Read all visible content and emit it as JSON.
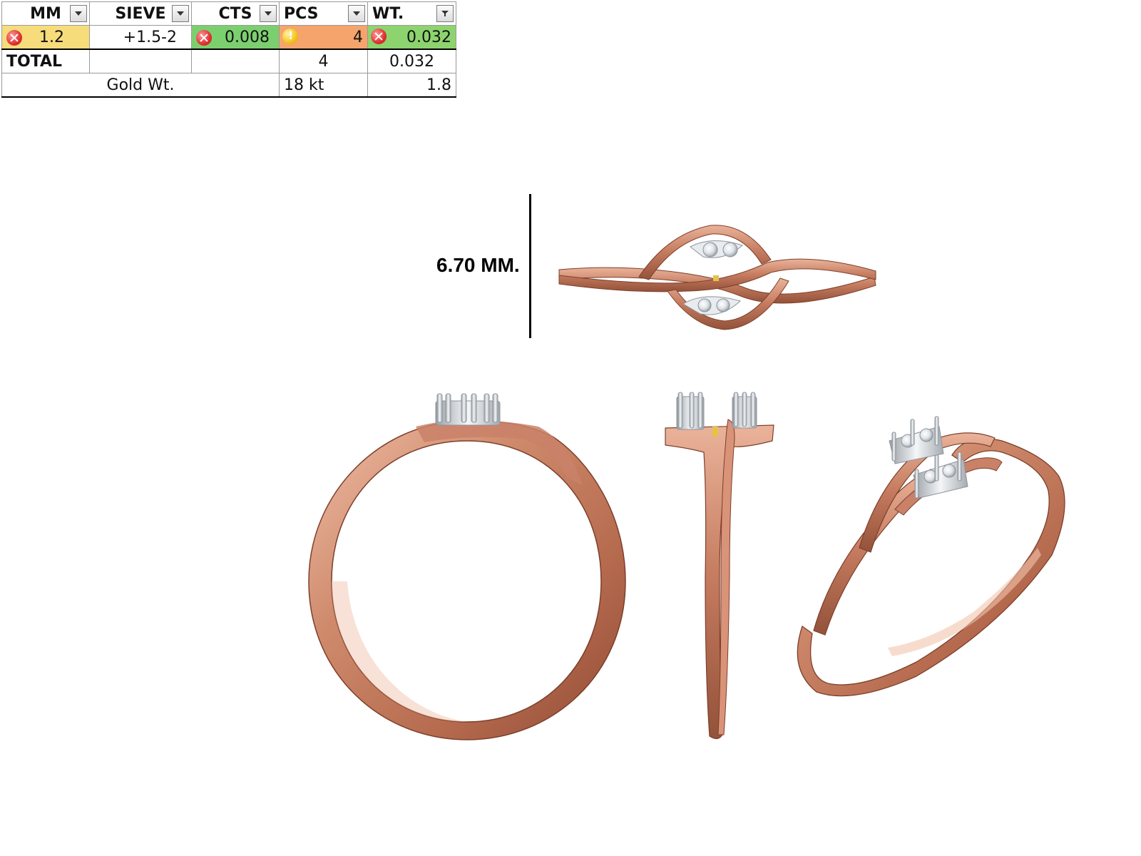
{
  "table": {
    "headers": [
      "MM",
      "SIEVE",
      "CTS",
      "PCS",
      "WT."
    ],
    "stone_row": {
      "mm": "1.2",
      "sieve": "+1.5-2",
      "cts": "0.008",
      "pcs": "4",
      "wt": "0.032"
    },
    "total_row": {
      "label": "TOTAL",
      "pcs": "4",
      "wt": "0.032"
    },
    "gold_row": {
      "label": "Gold Wt.",
      "karat": "18 kt",
      "weight": "1.8"
    }
  },
  "dimension": {
    "label": "6.70 MM."
  },
  "colors": {
    "rose_gold": "#c47a5e",
    "rose_gold_dark": "#8f4a34",
    "rose_gold_light": "#e9b39a",
    "white_gold": "#dfe2e6",
    "cell_yellow": "#f7dc7c",
    "cell_green": "#7ccf6f",
    "cell_orange": "#f5a46c",
    "error_red": "#e03030",
    "warning_yellow": "#f3c21b"
  }
}
